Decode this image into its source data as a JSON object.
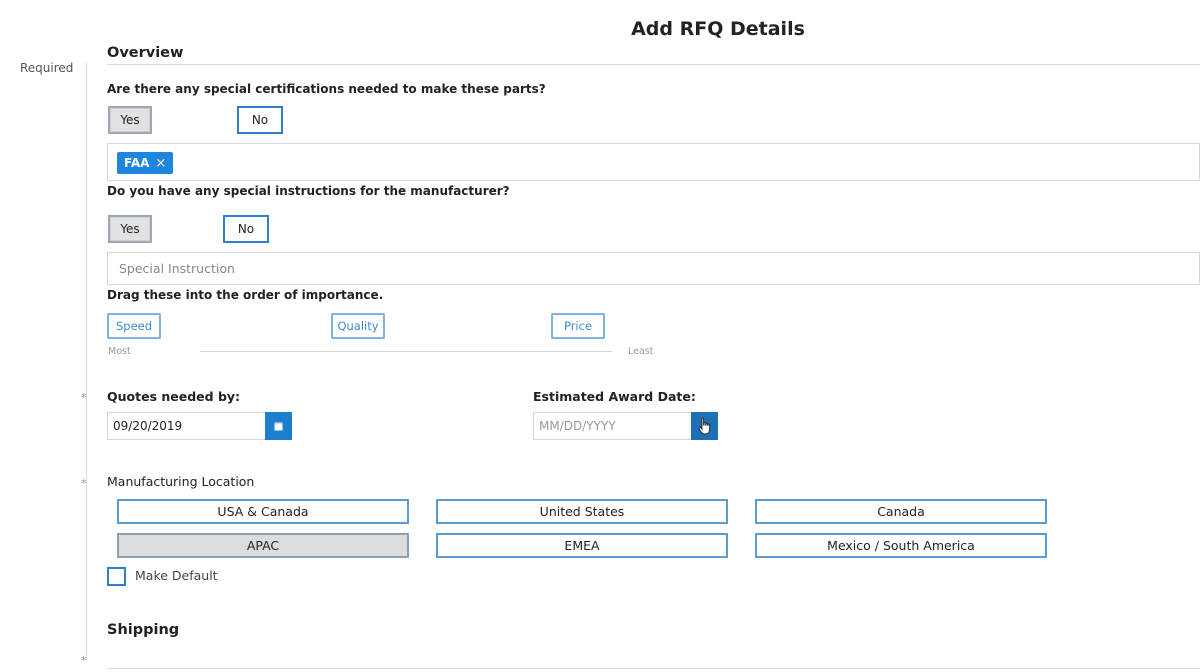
{
  "page": {
    "title": "Add RFQ Details",
    "required_label": "Required"
  },
  "overview": {
    "title": "Overview",
    "certifications": {
      "question": "Are there any special certifications needed to make these parts?",
      "yes_label": "Yes",
      "no_label": "No",
      "selected": "Yes",
      "tags": [
        {
          "label": "FAA",
          "remove_icon": "×"
        }
      ]
    },
    "instructions": {
      "question": "Do you have any special instructions for the manufacturer?",
      "yes_label": "Yes",
      "no_label": "No",
      "selected": "Yes",
      "placeholder": "Special Instruction"
    },
    "importance": {
      "prompt": "Drag these into the order of importance.",
      "items": [
        "Speed",
        "Quality",
        "Price"
      ],
      "most_label": "Most",
      "least_label": "Least"
    }
  },
  "dates": {
    "quotes_needed": {
      "label": "Quotes needed by:",
      "value": "09/20/2019",
      "icon": "calendar-icon"
    },
    "estimated_award": {
      "label": "Estimated Award Date:",
      "placeholder": "MM/DD/YYYY",
      "icon": "calendar-icon"
    }
  },
  "manufacturing_location": {
    "label": "Manufacturing Location",
    "options": [
      "USA & Canada",
      "United States",
      "Canada",
      "APAC",
      "EMEA",
      "Mexico / South America"
    ],
    "selected": "APAC",
    "make_default_label": "Make Default",
    "make_default_checked": false
  },
  "shipping": {
    "title": "Shipping"
  },
  "required_marker": "*",
  "colors": {
    "accent": "#1f86e0",
    "border_blue": "#2f80c8",
    "selected_gray": "#dcdcdc",
    "required_green": "#6aa86a"
  }
}
